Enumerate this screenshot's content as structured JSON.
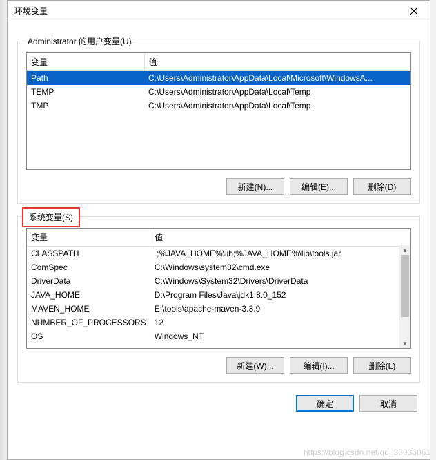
{
  "window": {
    "title": "环境变量"
  },
  "userSection": {
    "legend": "Administrator 的用户变量(U)",
    "headers": {
      "var": "变量",
      "val": "值"
    },
    "rows": [
      {
        "var": "Path",
        "val": "C:\\Users\\Administrator\\AppData\\Local\\Microsoft\\WindowsA..."
      },
      {
        "var": "TEMP",
        "val": "C:\\Users\\Administrator\\AppData\\Local\\Temp"
      },
      {
        "var": "TMP",
        "val": "C:\\Users\\Administrator\\AppData\\Local\\Temp"
      }
    ],
    "buttons": {
      "new": "新建(N)...",
      "edit": "编辑(E)...",
      "delete": "删除(D)"
    }
  },
  "systemSection": {
    "legend": "系统变量(S)",
    "headers": {
      "var": "变量",
      "val": "值"
    },
    "rows": [
      {
        "var": "CLASSPATH",
        "val": ".;%JAVA_HOME%\\lib;%JAVA_HOME%\\lib\\tools.jar"
      },
      {
        "var": "ComSpec",
        "val": "C:\\Windows\\system32\\cmd.exe"
      },
      {
        "var": "DriverData",
        "val": "C:\\Windows\\System32\\Drivers\\DriverData"
      },
      {
        "var": "JAVA_HOME",
        "val": "D:\\Program Files\\Java\\jdk1.8.0_152"
      },
      {
        "var": "MAVEN_HOME",
        "val": "E:\\tools\\apache-maven-3.3.9"
      },
      {
        "var": "NUMBER_OF_PROCESSORS",
        "val": "12"
      },
      {
        "var": "OS",
        "val": "Windows_NT"
      }
    ],
    "buttons": {
      "new": "新建(W)...",
      "edit": "编辑(I)...",
      "delete": "删除(L)"
    }
  },
  "bottom": {
    "ok": "确定",
    "cancel": "取消"
  },
  "watermark": "https://blog.csdn.net/qq_33036061"
}
